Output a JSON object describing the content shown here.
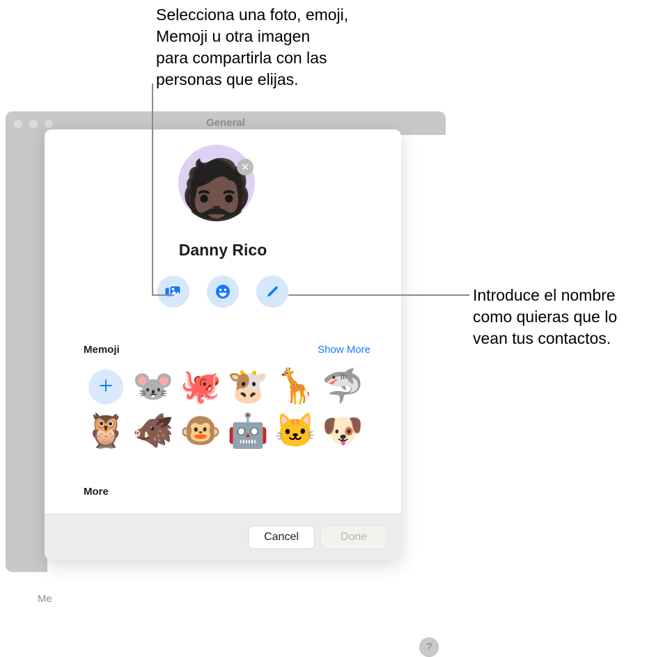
{
  "callouts": {
    "top": "Selecciona una foto, emoji,\nMemoji u otra imagen\npara compartirla con las\npersonas que elijas.",
    "right": "Introduce el nombre\ncomo quieras que lo\nvean tus contactos."
  },
  "background_window": {
    "title": "General",
    "sidebar_partial_label": "Me",
    "help_label": "?"
  },
  "sheet": {
    "avatar": {
      "memoji_glyph": "🧔🏿",
      "remove_label": "✕",
      "background_color": "#ddd2f2"
    },
    "contact_name": "Danny Rico",
    "action_buttons": [
      {
        "name": "photos",
        "label": "photo-library-icon"
      },
      {
        "name": "emoji",
        "label": "emoji-icon"
      },
      {
        "name": "monogram",
        "label": "pencil-icon"
      }
    ],
    "memoji_section": {
      "title": "Memoji",
      "show_more_label": "Show More",
      "add_label": "+",
      "items": [
        {
          "name": "mouse",
          "glyph": "🐭"
        },
        {
          "name": "octopus",
          "glyph": "🐙"
        },
        {
          "name": "cow",
          "glyph": "🐮"
        },
        {
          "name": "giraffe",
          "glyph": "🦒"
        },
        {
          "name": "shark",
          "glyph": "🦈"
        },
        {
          "name": "owl",
          "glyph": "🦉"
        },
        {
          "name": "boar",
          "glyph": "🐗"
        },
        {
          "name": "monkey",
          "glyph": "🐵"
        },
        {
          "name": "robot",
          "glyph": "🤖"
        },
        {
          "name": "cat",
          "glyph": "🐱"
        },
        {
          "name": "dog",
          "glyph": "🐶"
        }
      ]
    },
    "more_section": {
      "title": "More"
    },
    "footer": {
      "cancel_label": "Cancel",
      "done_label": "Done"
    }
  },
  "colors": {
    "accent_blue": "#1479ff",
    "action_button_bg": "#d5e7fb",
    "window_chrome": "#c8c8c8"
  }
}
